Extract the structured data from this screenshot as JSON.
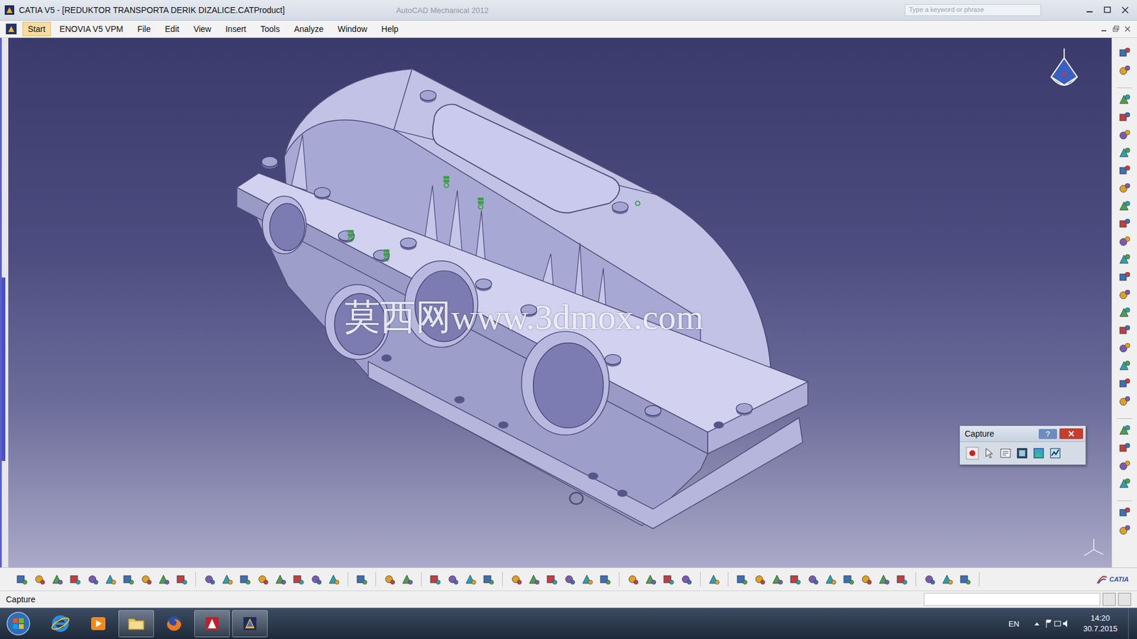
{
  "window": {
    "title": "CATIA V5 - [REDUKTOR TRANSPORTA DERIK DIZALICE.CATProduct]",
    "ghost_title": "AutoCAD Mechanical 2012",
    "search_placeholder": "Type a keyword or phrase"
  },
  "menu": [
    {
      "label": "Start",
      "selected": true
    },
    {
      "label": "ENOVIA V5 VPM",
      "selected": false
    },
    {
      "label": "File",
      "selected": false
    },
    {
      "label": "Edit",
      "selected": false
    },
    {
      "label": "View",
      "selected": false
    },
    {
      "label": "Insert",
      "selected": false
    },
    {
      "label": "Tools",
      "selected": false
    },
    {
      "label": "Analyze",
      "selected": false
    },
    {
      "label": "Window",
      "selected": false
    },
    {
      "label": "Help",
      "selected": false
    }
  ],
  "viewport": {
    "watermark": "莫西网www.3dmox.com"
  },
  "capture_panel": {
    "title": "Capture",
    "help": "?"
  },
  "brand": "CATIA",
  "status_bar": {
    "text": "Capture"
  },
  "taskbar": {
    "apps": [
      {
        "kind": "ie",
        "running": false
      },
      {
        "kind": "media",
        "running": false
      },
      {
        "kind": "folder",
        "running": true
      },
      {
        "kind": "firefox",
        "running": false
      },
      {
        "kind": "autocad",
        "running": true
      },
      {
        "kind": "catia",
        "running": true
      }
    ],
    "language": "EN",
    "time": "14:20",
    "date": "30.7.2015"
  }
}
